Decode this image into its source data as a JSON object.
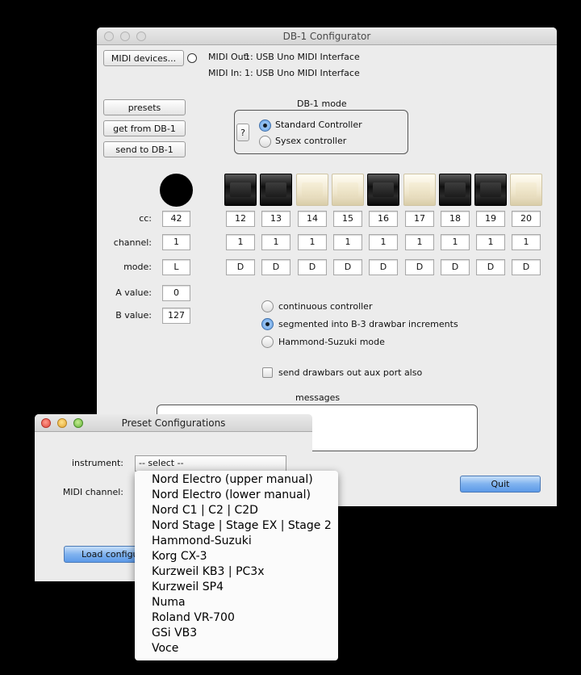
{
  "main_window": {
    "title": "DB-1 Configurator",
    "midi_devices_button": "MIDI devices...",
    "midi_out_label": "MIDI Out:",
    "midi_out_value": "1: USB Uno MIDI Interface",
    "midi_in_label": "MIDI In:",
    "midi_in_value": "1: USB Uno MIDI Interface",
    "presets_button": "presets",
    "get_button": "get from DB-1",
    "send_button": "send to DB-1",
    "mode_group_title": "DB-1 mode",
    "help_button": "?",
    "mode_options": [
      "Standard Controller",
      "Sysex controller"
    ],
    "mode_selected": 0,
    "row_labels": {
      "cc": "cc:",
      "channel": "channel:",
      "mode": "mode:",
      "a_value": "A value:",
      "b_value": "B value:"
    },
    "master": {
      "cc": "42",
      "channel": "1",
      "mode": "L",
      "a_value": "0",
      "b_value": "127"
    },
    "drawbars": [
      {
        "color": "black",
        "cc": "12",
        "channel": "1",
        "mode": "D"
      },
      {
        "color": "black",
        "cc": "13",
        "channel": "1",
        "mode": "D"
      },
      {
        "color": "white",
        "cc": "14",
        "channel": "1",
        "mode": "D"
      },
      {
        "color": "white",
        "cc": "15",
        "channel": "1",
        "mode": "D"
      },
      {
        "color": "black",
        "cc": "16",
        "channel": "1",
        "mode": "D"
      },
      {
        "color": "white",
        "cc": "17",
        "channel": "1",
        "mode": "D"
      },
      {
        "color": "black",
        "cc": "18",
        "channel": "1",
        "mode": "D"
      },
      {
        "color": "black",
        "cc": "19",
        "channel": "1",
        "mode": "D"
      },
      {
        "color": "white",
        "cc": "20",
        "channel": "1",
        "mode": "D"
      }
    ],
    "output_options": [
      "continuous controller",
      "segmented into B-3 drawbar increments",
      "Hammond-Suzuki mode"
    ],
    "output_selected": 1,
    "aux_checkbox_label": "send drawbars out aux port also",
    "aux_checked": false,
    "messages_label": "messages",
    "quit_button": "Quit"
  },
  "preset_window": {
    "title": "Preset Configurations",
    "instrument_label": "instrument:",
    "instrument_value": "-- select --",
    "midi_channel_label": "MIDI channel:",
    "load_button": "Load configuration",
    "dropdown_items": [
      "Nord Electro (upper manual)",
      "Nord Electro (lower manual)",
      "Nord C1 | C2 | C2D",
      "Nord Stage | Stage EX | Stage 2",
      "Hammond-Suzuki",
      "Korg CX-3",
      "Kurzweil KB3 | PC3x",
      "Kurzweil SP4",
      "Numa",
      "Roland VR-700",
      "GSi VB3",
      "Voce"
    ]
  }
}
